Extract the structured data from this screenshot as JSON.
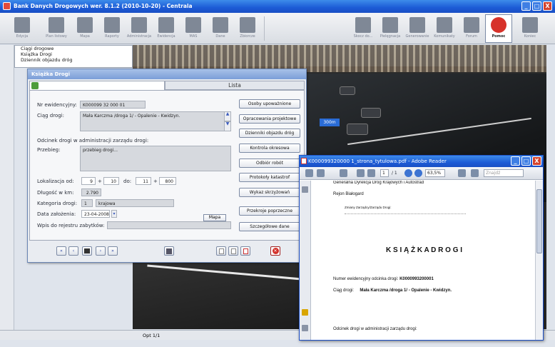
{
  "window": {
    "title": "Bank Danych Drogowych wer. 8.1.2 (2010-10-20) - Centrala",
    "min": "_",
    "max": "□",
    "close": "X"
  },
  "toolbar": [
    {
      "label": "Edycja"
    },
    {
      "label": "Plan listowy"
    },
    {
      "label": "Mapa"
    },
    {
      "label": "Raporty"
    },
    {
      "label": "Administracja"
    },
    {
      "label": "Ewidencja"
    },
    {
      "label": "MAS"
    },
    {
      "label": "Dane"
    },
    {
      "label": "Zbiorcze"
    },
    {
      "label": "Skocz do..."
    },
    {
      "label": "Pielęgnacja"
    },
    {
      "label": "Generowanie"
    },
    {
      "label": "Komunikaty"
    },
    {
      "label": "Forum"
    },
    {
      "label": "Pomoc"
    },
    {
      "label": "Koniec"
    }
  ],
  "tree": [
    "Ciągi drogowe",
    "Książka Drogi",
    "Dziennik objazdu dróg"
  ],
  "dialog": {
    "title": "Książka Drogi",
    "tab_list": "Lista",
    "nr_label": "Nr ewidencyjny:",
    "nr_value": "K000099 32 000 01",
    "ciag_label": "Ciąg drogi:",
    "ciag_value": "Mała Karczma /droga 1/ - Opalenie - Kwidzyn.",
    "odcinek_label": "Odcinek drogi w administracji zarządu drogi:",
    "przebieg_label": "Przebieg:",
    "przebieg_value": "przebieg drogi...",
    "lok_label": "Lokalizacja  od:",
    "lok_km1": "9",
    "lok_m1": "10",
    "lok_do": "do:",
    "lok_km2": "11",
    "lok_m2": "800",
    "plus": "+",
    "dl_label": "Długość w km:",
    "dl_value": "2.790",
    "kat_label": "Kategoria drogi:",
    "kat_code": "1",
    "kat_value": "krajowa",
    "data_label": "Data założenia:",
    "data_value": "23-04-2008",
    "mapa": "Mapa",
    "wpis_label": "Wpis do rejestru zabytków:",
    "buttons": [
      "Osoby upoważnione",
      "Opracowania projektowe",
      "Dzienniki objazdu dróg",
      "Kontrola okresowa",
      "Odbiór robót",
      "Protokoły katastrof",
      "Wykaz skrzyżowań",
      "Przekroje poprzeczne",
      "Szczegółowe dane"
    ],
    "nav": [
      "«",
      "‹",
      "›",
      "»"
    ]
  },
  "status": "Opt 1/1",
  "pdf": {
    "title": "K000099320000 1_strona_tytulowa.pdf - Adobe Reader",
    "page": "1",
    "pages": "/ 1",
    "zoom": "63,5%",
    "find": "Znajdź",
    "org": "Generalna Dyrekcja Dróg Krajowych i Autostrad",
    "rejon": "Rejon Białogard",
    "zmiany": "Zmiany Zarządcy/Zarządu Drogi:",
    "heading": "K S I Ą Ż K A   D R O G I",
    "nr_line_label": "Numer ewidencyjny odcinka drogi:",
    "nr_line_value": "K0000993200001",
    "ciag_line_label": "Ciąg drogi:",
    "ciag_line_value": "Mała Karczma /droga 1/ - Opalenie - Kwidzyn.",
    "odcinek_line": "Odcinek drogi w administracji zarządu drogi:"
  },
  "photo_sign": "300m"
}
